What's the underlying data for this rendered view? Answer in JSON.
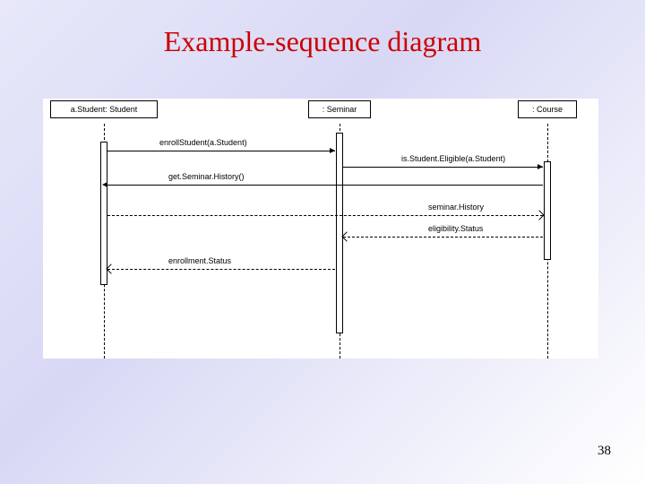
{
  "title": "Example-sequence diagram",
  "page_number": "38",
  "participants": {
    "p1": "a.Student: Student",
    "p2": ": Seminar",
    "p3": ": Course"
  },
  "messages": {
    "m1": "enrollStudent(a.Student)",
    "m2": "is.Student.Eligible(a.Student)",
    "m3": "get.Seminar.History()",
    "m4": "seminar.History",
    "m5": "eligibility.Status",
    "m6": "enrollment.Status"
  }
}
